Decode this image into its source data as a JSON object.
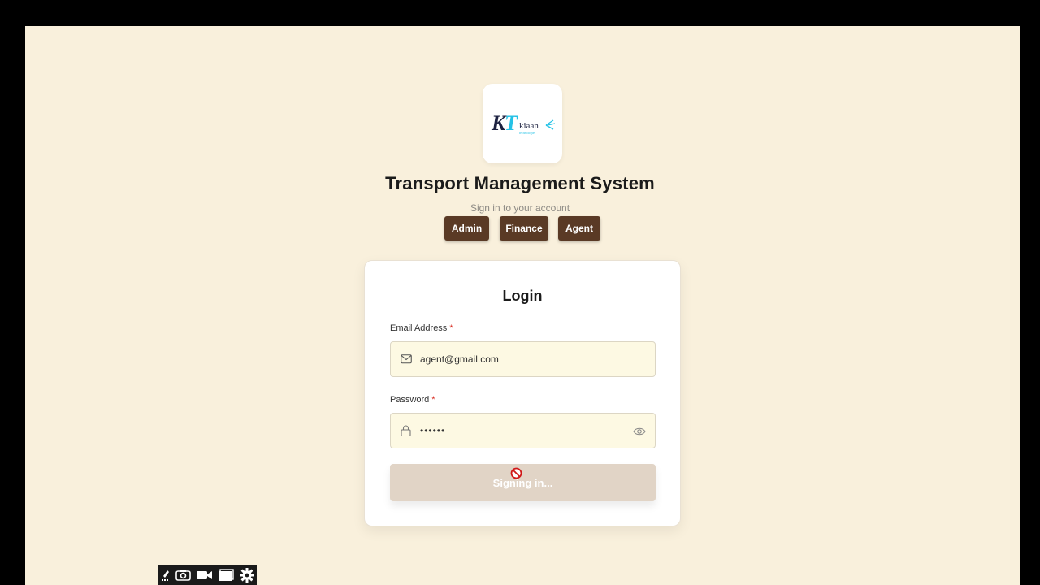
{
  "logo": {
    "icon": "kt-kiaan-logo-icon"
  },
  "header": {
    "title": "Transport Management System",
    "subtitle": "Sign in to your account"
  },
  "roles": [
    {
      "label": "Admin"
    },
    {
      "label": "Finance"
    },
    {
      "label": "Agent"
    }
  ],
  "login": {
    "title": "Login",
    "email": {
      "label": "Email Address",
      "required_mark": "*",
      "value": "agent@gmail.com",
      "icon": "mail-icon"
    },
    "password": {
      "label": "Password",
      "required_mark": "*",
      "value": "••••••",
      "icon": "lock-icon",
      "toggle_icon": "eye-icon"
    },
    "submit_label": "Signing in...",
    "submit_state": "disabled"
  },
  "toolbar": {
    "icons": [
      "edit-icon",
      "camera-icon",
      "video-icon",
      "window-icon",
      "gear-icon"
    ]
  },
  "colors": {
    "page_bg": "#f9f0dc",
    "role_button": "#5a3a25",
    "input_bg": "#fdf9e3",
    "submit_disabled": "#e1d4c6",
    "required": "#d93025"
  }
}
